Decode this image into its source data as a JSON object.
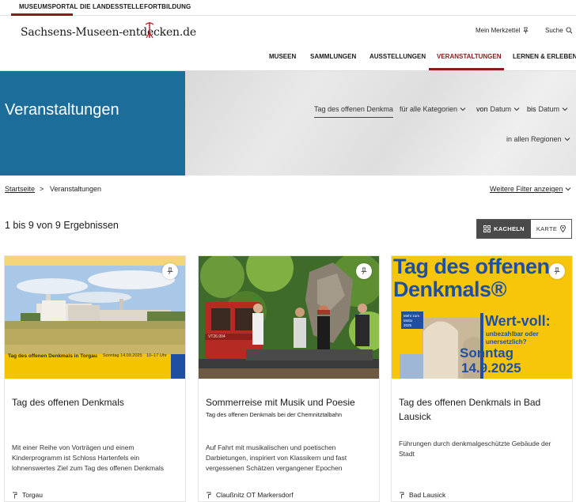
{
  "topbar": {
    "items": [
      "MUSEUMSPORTAL",
      "DIE LANDESSTELLE",
      "FORTBILDUNG"
    ]
  },
  "logo": {
    "text": "Sachsens-Museen-entdecken.de"
  },
  "utility": {
    "notepad": "Mein Merkzettel",
    "search": "Suche"
  },
  "mainnav": {
    "items": [
      "MUSEEN",
      "SAMMLUNGEN",
      "AUSSTELLUNGEN",
      "VERANSTALTUNGEN",
      "LERNEN & ERLEBEN"
    ],
    "active": "VERANSTALTUNGEN"
  },
  "hero": {
    "title": "Veranstaltungen",
    "search_value": "Tag des offenen Denkma",
    "category": "für alle Kategorien",
    "from_label": "von",
    "from_value": "Datum",
    "to_label": "bis",
    "to_value": "Datum",
    "region": "in allen Regionen"
  },
  "breadcrumb": {
    "home": "Startseite",
    "separator": ">",
    "current": "Veranstaltungen"
  },
  "more_filters": "Weitere Filter anzeigen",
  "results": {
    "text": "1 bis 9 von 9 Ergebnissen",
    "view_tiles": "KACHELN",
    "view_map": "KARTE"
  },
  "cards": [
    {
      "title": "Tag des offenen Denkmals",
      "subtitle": "",
      "description": "Mit einer Reihe von Vorträgen und einem Kinderprogramm ist Schloss Hartenfels ein lohnenswertes Ziel zum Tag des offenen Denkmals",
      "location": "Torgau",
      "banner": {
        "text": "Tag des offenen Denkmals in Torgau",
        "date": "Sonntag 14.09.2025",
        "time": "10–17 Uhr"
      }
    },
    {
      "title": "Sommerreise mit Musik und Poesie",
      "subtitle": "Tag des offenen Denkmals bei der Chemnitztalbahn",
      "description": "Auf Fahrt mit musikalischen und poetischen Darbietungen, inspiriert von Klassikern und fast vergessenen Schätzen vergangener Epochen",
      "location": "Claußnitz OT Markersdorf",
      "plate": "VT26.004"
    },
    {
      "title": "Tag des offenen Denkmals in Bad Lausick",
      "subtitle": "",
      "description": "Führungen durch denkmalgeschützte Gebäude der Stadt",
      "location": "Bad Lausick",
      "poster": {
        "line1": "Tag des offenen",
        "line2": "Denkmals®",
        "badge": "Mehr zum Motto 2025",
        "motto": "Wert-voll:",
        "motto_sub1": "unbezahlbar oder",
        "motto_sub2": "unersetzlich?",
        "day": "Sonntag",
        "date": "14.9.2025"
      }
    }
  ],
  "colors": {
    "accent": "#8b1a1a",
    "hero_blue": "#1d6d9b",
    "poster_yellow": "#f7c60b",
    "poster_blue": "#1f4fa3"
  }
}
